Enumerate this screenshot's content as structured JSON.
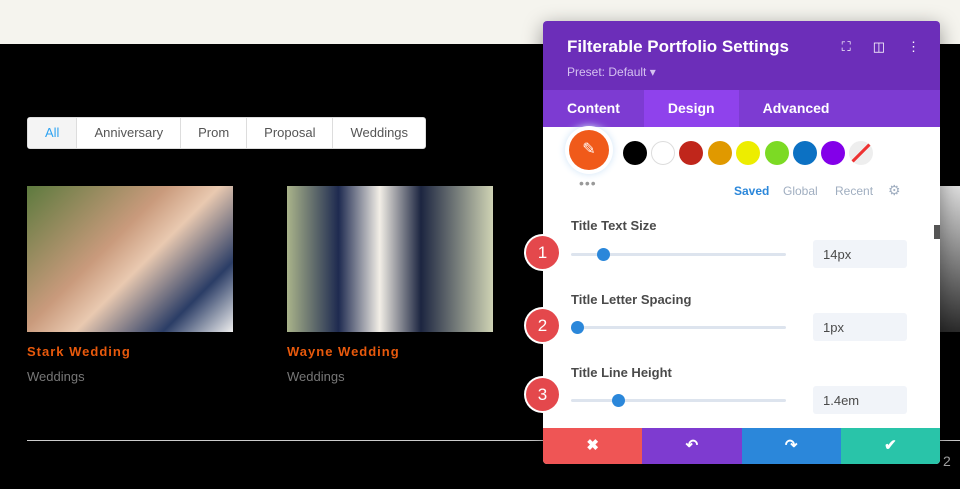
{
  "filters": [
    "All",
    "Anniversary",
    "Prom",
    "Proposal",
    "Weddings"
  ],
  "items": [
    {
      "title": "Stark Wedding",
      "category": "Weddings"
    },
    {
      "title": "Wayne Wedding",
      "category": "Weddings"
    }
  ],
  "pagination": {
    "page": "2"
  },
  "panel": {
    "title": "Filterable Portfolio Settings",
    "preset": "Preset: Default ▾",
    "tabs": [
      "Content",
      "Design",
      "Advanced"
    ],
    "swatches": [
      "#000000",
      "#ffffff",
      "#c0261b",
      "#e09900",
      "#eded00",
      "#7cda24",
      "#0c71c3",
      "#8300e9"
    ],
    "color_tabs": [
      "Saved",
      "Global",
      "Recent"
    ],
    "settings": [
      {
        "label": "Title Text Size",
        "value": "14px",
        "fraction": 0.15
      },
      {
        "label": "Title Letter Spacing",
        "value": "1px",
        "fraction": 0.03
      },
      {
        "label": "Title Line Height",
        "value": "1.4em",
        "fraction": 0.22
      }
    ],
    "footer": {
      "cancel": "✖",
      "undo": "↶",
      "redo": "↷",
      "save": "✔"
    }
  },
  "badges": [
    "1",
    "2",
    "3"
  ]
}
